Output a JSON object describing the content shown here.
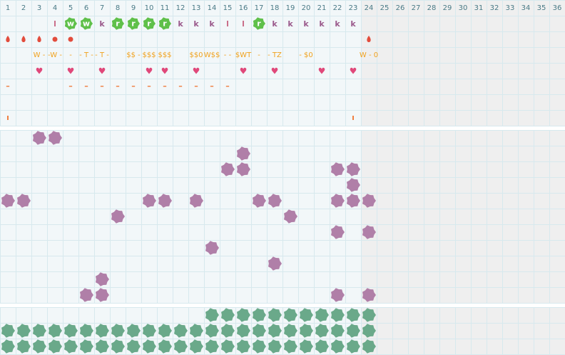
{
  "colors": {
    "grid_bg": "#f2f7f9",
    "grid_line": "#d7e9ee",
    "unused_bg": "#efefef",
    "separator": "#ffffff",
    "header_text": "#4a7a86",
    "letter_k": "#9b5a8c",
    "letter_l": "#c86a86",
    "green_tile": "#5fc04a",
    "drop": "#e24c3c",
    "sequence": "#f0a21e",
    "heart": "#e0487a",
    "dash": "#f07a3a",
    "purple_block": "#b07fa8",
    "teal_block": "#6aa98a"
  },
  "columns": [
    "1",
    "2",
    "3",
    "4",
    "5",
    "6",
    "7",
    "8",
    "9",
    "10",
    "11",
    "12",
    "13",
    "14",
    "15",
    "16",
    "17",
    "18",
    "19",
    "20",
    "21",
    "22",
    "23",
    "24",
    "25",
    "26",
    "27",
    "28",
    "29",
    "30",
    "31",
    "32",
    "33",
    "34",
    "35",
    "36"
  ],
  "letters_row": {
    "l_cols": [
      4,
      15,
      16
    ],
    "w_tiles": [
      {
        "col": 5,
        "text": "w"
      },
      {
        "col": 6,
        "text": "w"
      }
    ],
    "k_cols": [
      7,
      12,
      13,
      14,
      18,
      19,
      20,
      21,
      22,
      23
    ],
    "r_tiles": [
      {
        "col": 8,
        "text": "r"
      },
      {
        "col": 9,
        "text": "r"
      },
      {
        "col": 10,
        "text": "r"
      },
      {
        "col": 11,
        "text": "r"
      },
      {
        "col": 17,
        "text": "r"
      }
    ]
  },
  "markers_row": {
    "drop_cols": [
      1,
      2,
      3,
      24
    ],
    "dot_cols": [
      4,
      5
    ]
  },
  "sequence_row": [
    {
      "col": 3,
      "text": "W -"
    },
    {
      "col": 4,
      "text": "-W -"
    },
    {
      "col": 5,
      "text": "-"
    },
    {
      "col": 6,
      "text": "- T -"
    },
    {
      "col": 7,
      "text": "- T -"
    },
    {
      "col": 9,
      "text": "$$ -"
    },
    {
      "col": 10,
      "text": "$$$"
    },
    {
      "col": 11,
      "text": "$$$"
    },
    {
      "col": 13,
      "text": "$$0"
    },
    {
      "col": 14,
      "text": "W$$"
    },
    {
      "col": 15,
      "text": "- -"
    },
    {
      "col": 16,
      "text": "$WT"
    },
    {
      "col": 17,
      "text": "-"
    },
    {
      "col": 18,
      "text": "- TZ"
    },
    {
      "col": 20,
      "text": "- $0"
    },
    {
      "col": 24,
      "text": "W - 0"
    }
  ],
  "hearts_row": {
    "cols": [
      3,
      5,
      7,
      10,
      11,
      13,
      16,
      18,
      21,
      23
    ],
    "glyph": "♥"
  },
  "dash_row": {
    "cols": [
      1,
      5,
      6,
      7,
      8,
      9,
      10,
      11,
      12,
      13,
      14,
      15
    ],
    "glyph": "–"
  },
  "tick_row": {
    "cols": [
      1,
      23
    ],
    "glyph": "ı"
  },
  "purple_blocks": [
    [
      3,
      1
    ],
    [
      4,
      1
    ],
    [
      16,
      2
    ],
    [
      15,
      3
    ],
    [
      16,
      3
    ],
    [
      22,
      3
    ],
    [
      23,
      3
    ],
    [
      23,
      4
    ],
    [
      1,
      5
    ],
    [
      2,
      5
    ],
    [
      10,
      5
    ],
    [
      11,
      5
    ],
    [
      13,
      5
    ],
    [
      17,
      5
    ],
    [
      18,
      5
    ],
    [
      22,
      5
    ],
    [
      23,
      5
    ],
    [
      24,
      5
    ],
    [
      8,
      6
    ],
    [
      19,
      6
    ],
    [
      22,
      7
    ],
    [
      24,
      7
    ],
    [
      14,
      8
    ],
    [
      18,
      9
    ],
    [
      7,
      10
    ],
    [
      6,
      11
    ],
    [
      7,
      11
    ],
    [
      22,
      11
    ],
    [
      24,
      11
    ]
  ],
  "teal_blocks": {
    "row1": [
      14,
      24
    ],
    "row2": [
      1,
      24
    ],
    "row3": [
      1,
      24
    ]
  }
}
